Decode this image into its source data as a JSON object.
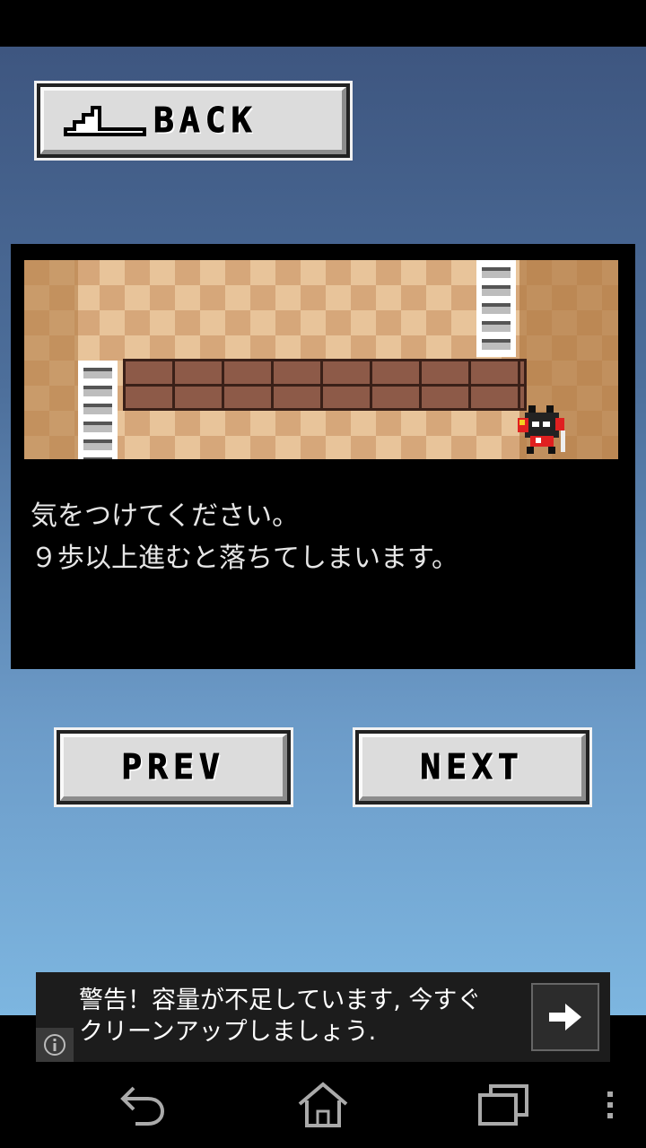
{
  "buttons": {
    "back_label": "BACK",
    "prev_label": "PREV",
    "next_label": "NEXT"
  },
  "message": {
    "line1": "気をつけてください。",
    "line2": "９歩以上進むと落ちてしまいます。"
  },
  "ad": {
    "line1": "警告！容量が不足しています, 今すぐ",
    "line2": "クリーンアップしましょう.",
    "info_icon": "info-icon",
    "action_icon": "arrow-right-icon"
  },
  "navbar": {
    "icons": [
      "back-icon",
      "home-icon",
      "recents-icon",
      "menu-icon"
    ]
  },
  "colors": {
    "background_top": "#3e5680",
    "background_bottom": "#7db6e0",
    "panel": "#000000",
    "button_face": "#dcdcdc"
  }
}
